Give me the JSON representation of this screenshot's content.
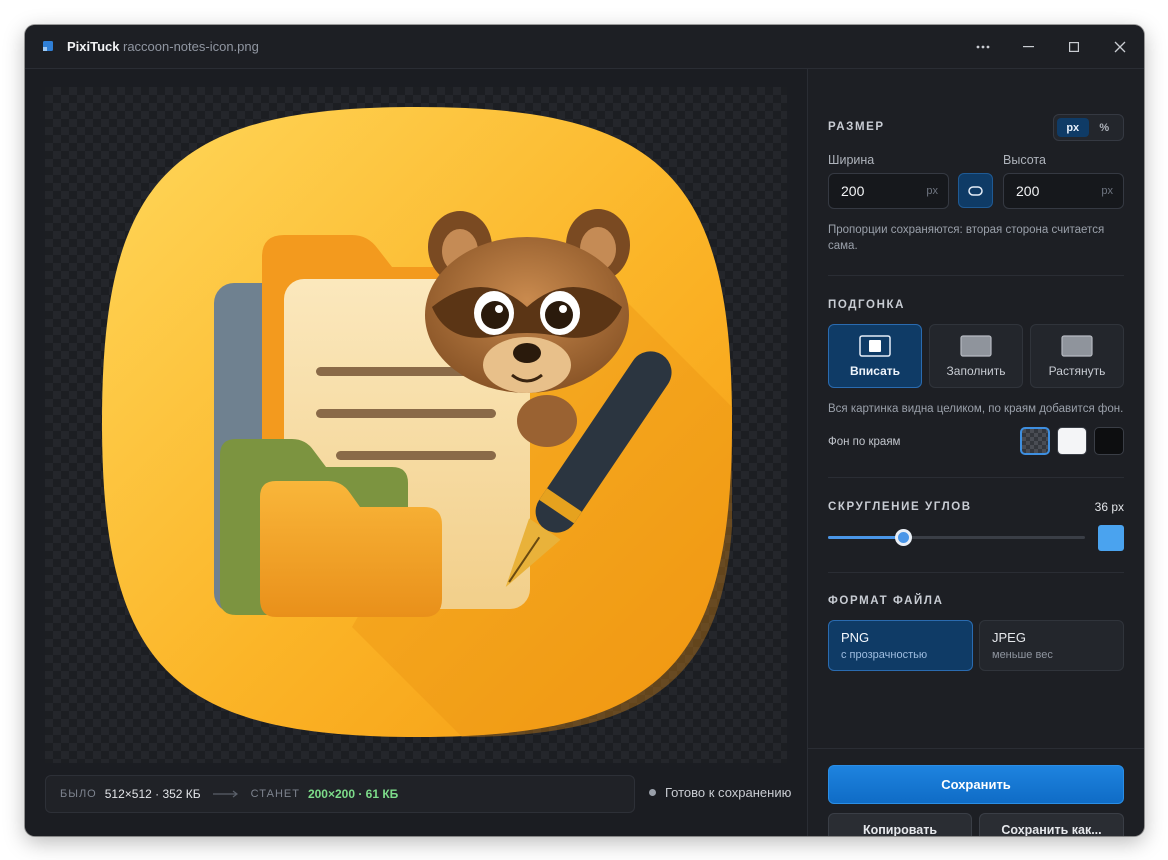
{
  "app": {
    "name": "PixiTuck",
    "file_name": "raccoon-notes-icon.png"
  },
  "size": {
    "title": "РАЗМЕР",
    "units": [
      "px",
      "%"
    ],
    "active_unit": "px",
    "width_label": "Ширина",
    "width_value": "200",
    "height_label": "Высота",
    "height_value": "200",
    "unit_suffix": "px",
    "hint": "Пропорции сохраняются: вторая сторона считается сама."
  },
  "fit": {
    "title": "ПОДГОНКА",
    "options": [
      "Вписать",
      "Заполнить",
      "Растянуть"
    ],
    "active": "Вписать",
    "hint": "Вся картинка видна целиком, по краям добавится фон.",
    "bg_label": "Фон по краям",
    "bg_swatches": [
      "transparent",
      "#f4f5f7",
      "#0d0e10"
    ]
  },
  "corners": {
    "title": "СКРУГЛЕНИЕ УГЛОВ",
    "value_text": "36 px",
    "value": 36,
    "slider_fraction": 0.29
  },
  "format": {
    "title": "ФОРМАТ ФАЙЛА",
    "options": [
      {
        "name": "PNG",
        "note": "с прозрачностью"
      },
      {
        "name": "JPEG",
        "note": "меньше вес"
      }
    ],
    "active": "PNG"
  },
  "actions": {
    "save": "Сохранить",
    "copy": "Копировать",
    "save_as": "Сохранить как..."
  },
  "info": {
    "before_label": "БЫЛО",
    "before_value": "512×512 · 352 КБ",
    "after_label": "СТАНЕТ",
    "after_value": "200×200 · 61 КБ",
    "status": "Готово к сохранению"
  },
  "colors": {
    "accent": "#1e83df",
    "active_bg": "#0f3b66",
    "success": "#7ddc8a"
  }
}
